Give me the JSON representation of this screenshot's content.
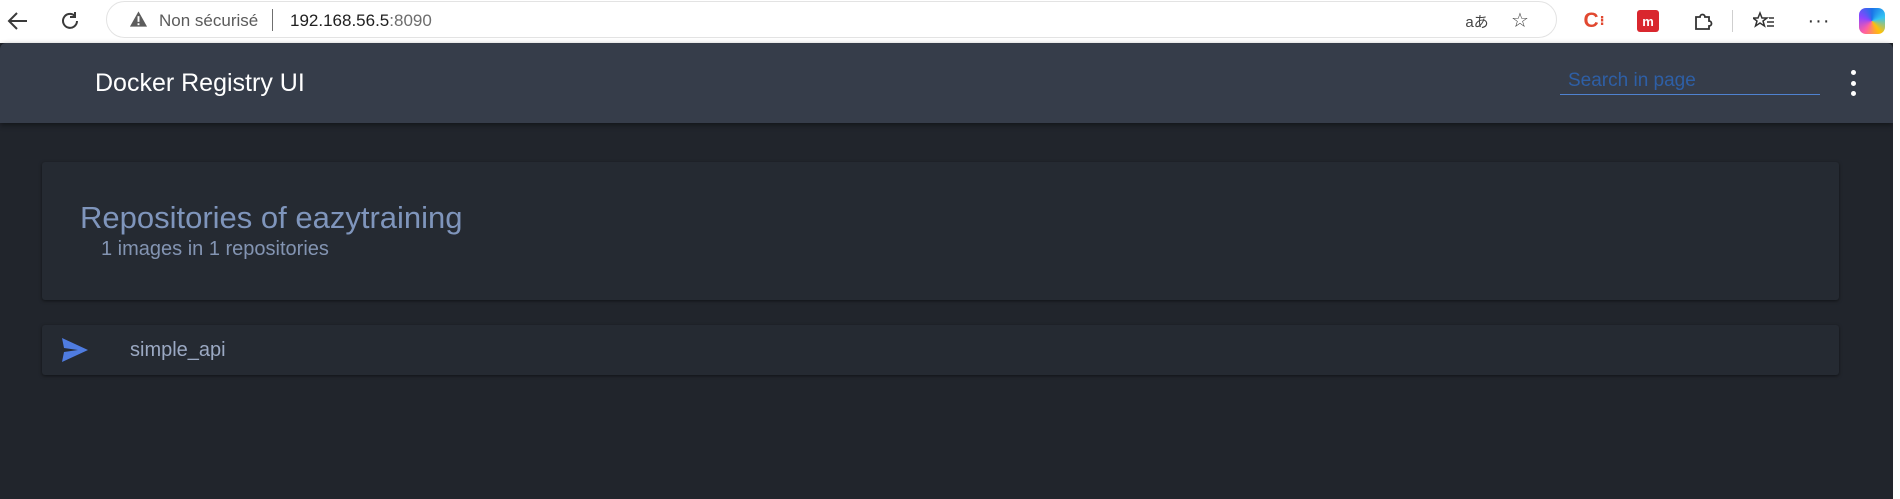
{
  "browser": {
    "security_label": "Non sécurisé",
    "url_host": "192.168.56.5",
    "url_port": ":8090",
    "read_aloud_glyph": "aあ",
    "extensions": [
      "C",
      "m",
      "puzzle-icon",
      "favorites-icon",
      "more-icon",
      "copilot-icon"
    ]
  },
  "app": {
    "title": "Docker Registry UI",
    "search_placeholder": "Search in page"
  },
  "main": {
    "heading": "Repositories of eazytraining",
    "summary": "1 images in 1 repositories",
    "repositories": [
      {
        "name": "simple_api",
        "icon": "send-icon"
      }
    ]
  },
  "colors": {
    "header_bg": "#363d4a",
    "page_bg": "#21252c",
    "card_bg": "#252a32",
    "accent": "#4f7ce0"
  }
}
